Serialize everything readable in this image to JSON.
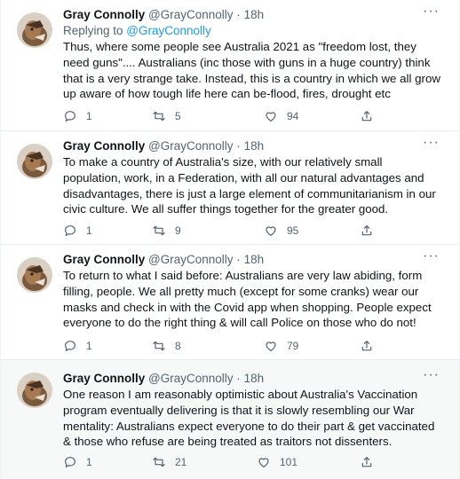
{
  "tweets": [
    {
      "name": "Gray Connolly",
      "handle": "@GrayConnolly",
      "sep": "·",
      "time": "18h",
      "replying_prefix": "Replying to ",
      "replying_handle": "@GrayConnolly",
      "text": "Thus, where some people see Australia 2021 as \"freedom lost, they need guns\".... Australians (inc those with guns in a huge country) think that is a very strange take. Instead, this is a country in which we all grow up aware of how tough life here can be-flood, fires, drought etc",
      "replies": "1",
      "retweets": "5",
      "likes": "94"
    },
    {
      "name": "Gray Connolly",
      "handle": "@GrayConnolly",
      "sep": "·",
      "time": "18h",
      "text": "To make a country of Australia's size, with our relatively small population, work, in a Federation, with all our natural advantages and disadvantages, there is just a large element of communitarianism in our civic culture. We all suffer things together for the greater good.",
      "replies": "1",
      "retweets": "9",
      "likes": "95"
    },
    {
      "name": "Gray Connolly",
      "handle": "@GrayConnolly",
      "sep": "·",
      "time": "18h",
      "text": "To return to what I said before: Australians are very law abiding, form filling, people.  We all pretty much (except for some cranks) wear our masks and check in with the Covid app when shopping. People expect everyone to do the right thing & will call Police on those who do not!",
      "replies": "1",
      "retweets": "8",
      "likes": "79"
    },
    {
      "name": "Gray Connolly",
      "handle": "@GrayConnolly",
      "sep": "·",
      "time": "18h",
      "text": "One reason I am reasonably optimistic about Australia's Vaccination program eventually delivering is that it is slowly resembling our War mentality: Australians expect everyone to do their part & get vaccinated & those who refuse are being treated as traitors not dissenters.",
      "replies": "1",
      "retweets": "21",
      "likes": "101"
    }
  ],
  "icons": {
    "reply": "reply-icon",
    "retweet": "retweet-icon",
    "like": "heart-icon",
    "share": "share-icon",
    "more": "more-icon"
  },
  "colors": {
    "text": "#0f1419",
    "secondary": "#536471",
    "link": "#1d9bf0",
    "highlight_bg": "#f7f9f9",
    "divider": "#e6ecf0"
  }
}
